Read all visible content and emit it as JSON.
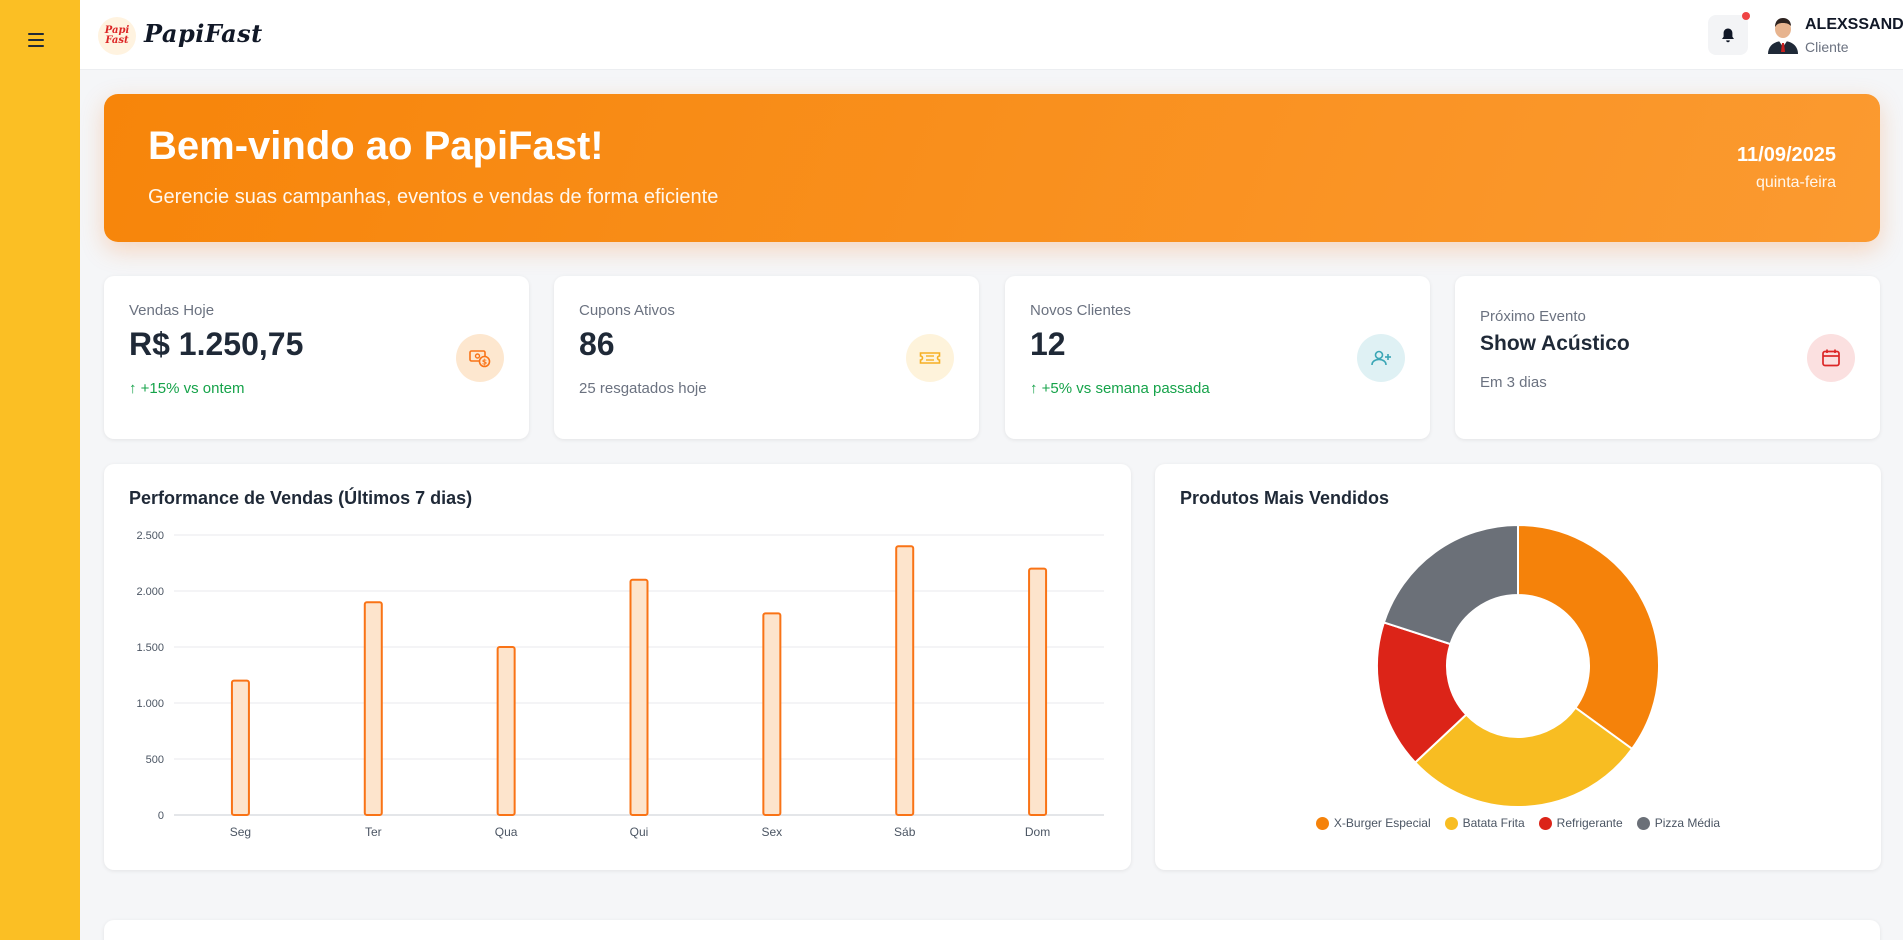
{
  "header": {
    "logo_badge_line1": "Papi",
    "logo_badge_line2": "Fast",
    "logo_text": "PapiFast",
    "user_name": "ALEXSSANDRO B Q",
    "user_role": "Cliente",
    "caret": "⌄"
  },
  "hero": {
    "title": "Bem-vindo ao PapiFast!",
    "subtitle": "Gerencie suas campanhas, eventos e vendas de forma eficiente",
    "date": "11/09/2025",
    "weekday": "quinta-feira"
  },
  "stats": [
    {
      "label": "Vendas Hoje",
      "value": "R$ 1.250,75",
      "footer": "↑ +15% vs ontem",
      "icon": "money-icon",
      "icon_bg": "#fde7cf",
      "icon_color": "#f97316"
    },
    {
      "label": "Cupons Ativos",
      "value": "86",
      "footer": "25 resgatados hoje",
      "icon": "ticket-icon",
      "icon_bg": "#fef3db",
      "icon_color": "#f5b024"
    },
    {
      "label": "Novos Clientes",
      "value": "12",
      "footer": "↑ +5% vs semana passada",
      "icon": "user-plus-icon",
      "icon_bg": "#dff1f4",
      "icon_color": "#3aa6b5"
    },
    {
      "label": "Próximo Evento",
      "value": "Show Acústico",
      "footer": "Em 3 dias",
      "icon": "calendar-icon",
      "icon_bg": "#fbe0e0",
      "icon_color": "#dc2626"
    }
  ],
  "colors": {
    "accent": "#f97316",
    "sidebar": "#fbbf24",
    "positive": "#16a34a"
  },
  "chart_data": [
    {
      "type": "bar",
      "title": "Performance de Vendas (Últimos 7 dias)",
      "categories": [
        "Seg",
        "Ter",
        "Qua",
        "Qui",
        "Sex",
        "Sáb",
        "Dom"
      ],
      "values": [
        1200,
        1900,
        1500,
        2100,
        1800,
        2400,
        2200
      ],
      "ylim": [
        0,
        2500
      ],
      "yticks": [
        0,
        500,
        1000,
        1500,
        2000,
        2500
      ],
      "ytick_labels": [
        "0",
        "500",
        "1.000",
        "1.500",
        "2.000",
        "2.500"
      ],
      "grid": true,
      "bar_color": "#f97316",
      "bar_fill": "#fde4cc"
    },
    {
      "type": "pie",
      "title": "Produtos Mais Vendidos",
      "categories": [
        "X-Burger Especial",
        "Batata Frita",
        "Refrigerante",
        "Pizza Média"
      ],
      "values": [
        35,
        28,
        17,
        20
      ],
      "colors": [
        "#f5820a",
        "#f8bd22",
        "#dc2418",
        "#6b7078"
      ],
      "legend": "bottom"
    }
  ]
}
